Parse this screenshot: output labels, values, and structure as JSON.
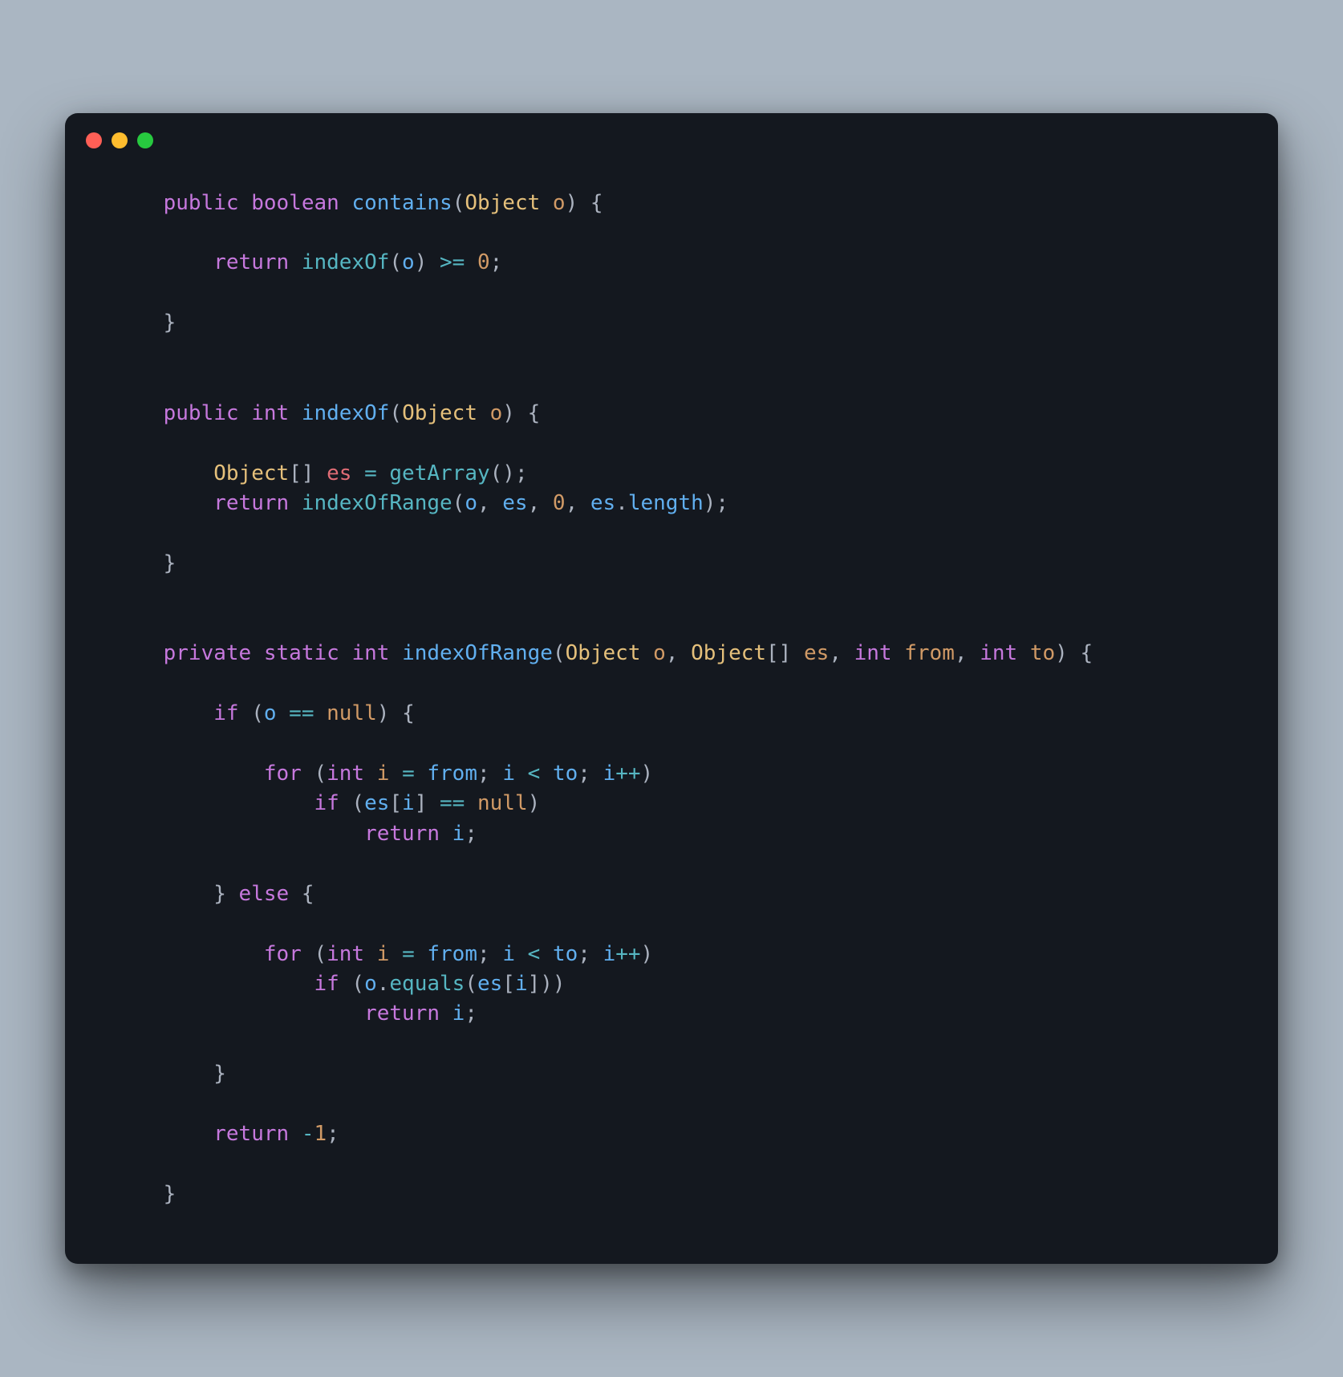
{
  "window": {
    "traffic_lights": [
      "close",
      "minimize",
      "zoom"
    ]
  },
  "code": {
    "tokens": [
      [
        {
          "t": "plain",
          "v": "    "
        },
        {
          "t": "kw",
          "v": "public"
        },
        {
          "t": "plain",
          "v": " "
        },
        {
          "t": "type",
          "v": "boolean"
        },
        {
          "t": "plain",
          "v": " "
        },
        {
          "t": "fn2",
          "v": "contains"
        },
        {
          "t": "punc",
          "v": "("
        },
        {
          "t": "cls",
          "v": "Object"
        },
        {
          "t": "plain",
          "v": " "
        },
        {
          "t": "param",
          "v": "o"
        },
        {
          "t": "punc",
          "v": ")"
        },
        {
          "t": "plain",
          "v": " "
        },
        {
          "t": "punc",
          "v": "{"
        }
      ],
      [],
      [
        {
          "t": "plain",
          "v": "        "
        },
        {
          "t": "kw",
          "v": "return"
        },
        {
          "t": "plain",
          "v": " "
        },
        {
          "t": "fn",
          "v": "indexOf"
        },
        {
          "t": "punc",
          "v": "("
        },
        {
          "t": "var",
          "v": "o"
        },
        {
          "t": "punc",
          "v": ")"
        },
        {
          "t": "plain",
          "v": " "
        },
        {
          "t": "op",
          "v": ">="
        },
        {
          "t": "plain",
          "v": " "
        },
        {
          "t": "num",
          "v": "0"
        },
        {
          "t": "punc",
          "v": ";"
        }
      ],
      [],
      [
        {
          "t": "plain",
          "v": "    "
        },
        {
          "t": "punc",
          "v": "}"
        }
      ],
      [],
      [],
      [
        {
          "t": "plain",
          "v": "    "
        },
        {
          "t": "kw",
          "v": "public"
        },
        {
          "t": "plain",
          "v": " "
        },
        {
          "t": "type",
          "v": "int"
        },
        {
          "t": "plain",
          "v": " "
        },
        {
          "t": "fn2",
          "v": "indexOf"
        },
        {
          "t": "punc",
          "v": "("
        },
        {
          "t": "cls",
          "v": "Object"
        },
        {
          "t": "plain",
          "v": " "
        },
        {
          "t": "param",
          "v": "o"
        },
        {
          "t": "punc",
          "v": ")"
        },
        {
          "t": "plain",
          "v": " "
        },
        {
          "t": "punc",
          "v": "{"
        }
      ],
      [],
      [
        {
          "t": "plain",
          "v": "        "
        },
        {
          "t": "cls",
          "v": "Object"
        },
        {
          "t": "punc",
          "v": "[]"
        },
        {
          "t": "plain",
          "v": " "
        },
        {
          "t": "decl",
          "v": "es"
        },
        {
          "t": "plain",
          "v": " "
        },
        {
          "t": "op",
          "v": "="
        },
        {
          "t": "plain",
          "v": " "
        },
        {
          "t": "fn",
          "v": "getArray"
        },
        {
          "t": "punc",
          "v": "();"
        }
      ],
      [
        {
          "t": "plain",
          "v": "        "
        },
        {
          "t": "kw",
          "v": "return"
        },
        {
          "t": "plain",
          "v": " "
        },
        {
          "t": "fn",
          "v": "indexOfRange"
        },
        {
          "t": "punc",
          "v": "("
        },
        {
          "t": "var",
          "v": "o"
        },
        {
          "t": "punc",
          "v": ", "
        },
        {
          "t": "var",
          "v": "es"
        },
        {
          "t": "punc",
          "v": ", "
        },
        {
          "t": "num",
          "v": "0"
        },
        {
          "t": "punc",
          "v": ", "
        },
        {
          "t": "var",
          "v": "es"
        },
        {
          "t": "punc",
          "v": "."
        },
        {
          "t": "var",
          "v": "length"
        },
        {
          "t": "punc",
          "v": ");"
        }
      ],
      [],
      [
        {
          "t": "plain",
          "v": "    "
        },
        {
          "t": "punc",
          "v": "}"
        }
      ],
      [],
      [],
      [
        {
          "t": "plain",
          "v": "    "
        },
        {
          "t": "kw",
          "v": "private"
        },
        {
          "t": "plain",
          "v": " "
        },
        {
          "t": "kw",
          "v": "static"
        },
        {
          "t": "plain",
          "v": " "
        },
        {
          "t": "type",
          "v": "int"
        },
        {
          "t": "plain",
          "v": " "
        },
        {
          "t": "fn2",
          "v": "indexOfRange"
        },
        {
          "t": "punc",
          "v": "("
        },
        {
          "t": "cls",
          "v": "Object"
        },
        {
          "t": "plain",
          "v": " "
        },
        {
          "t": "param",
          "v": "o"
        },
        {
          "t": "punc",
          "v": ", "
        },
        {
          "t": "cls",
          "v": "Object"
        },
        {
          "t": "punc",
          "v": "[] "
        },
        {
          "t": "param",
          "v": "es"
        },
        {
          "t": "punc",
          "v": ", "
        },
        {
          "t": "type",
          "v": "int"
        },
        {
          "t": "plain",
          "v": " "
        },
        {
          "t": "param",
          "v": "from"
        },
        {
          "t": "punc",
          "v": ", "
        },
        {
          "t": "type",
          "v": "int"
        },
        {
          "t": "plain",
          "v": " "
        },
        {
          "t": "param",
          "v": "to"
        },
        {
          "t": "punc",
          "v": ")"
        },
        {
          "t": "plain",
          "v": " "
        },
        {
          "t": "punc",
          "v": "{"
        }
      ],
      [],
      [
        {
          "t": "plain",
          "v": "        "
        },
        {
          "t": "kw",
          "v": "if"
        },
        {
          "t": "plain",
          "v": " "
        },
        {
          "t": "punc",
          "v": "("
        },
        {
          "t": "var",
          "v": "o"
        },
        {
          "t": "plain",
          "v": " "
        },
        {
          "t": "op",
          "v": "=="
        },
        {
          "t": "plain",
          "v": " "
        },
        {
          "t": "lit",
          "v": "null"
        },
        {
          "t": "punc",
          "v": ")"
        },
        {
          "t": "plain",
          "v": " "
        },
        {
          "t": "punc",
          "v": "{"
        }
      ],
      [],
      [
        {
          "t": "plain",
          "v": "            "
        },
        {
          "t": "kw",
          "v": "for"
        },
        {
          "t": "plain",
          "v": " "
        },
        {
          "t": "punc",
          "v": "("
        },
        {
          "t": "type",
          "v": "int"
        },
        {
          "t": "plain",
          "v": " "
        },
        {
          "t": "param",
          "v": "i"
        },
        {
          "t": "plain",
          "v": " "
        },
        {
          "t": "op",
          "v": "="
        },
        {
          "t": "plain",
          "v": " "
        },
        {
          "t": "var",
          "v": "from"
        },
        {
          "t": "punc",
          "v": "; "
        },
        {
          "t": "var",
          "v": "i"
        },
        {
          "t": "plain",
          "v": " "
        },
        {
          "t": "op",
          "v": "<"
        },
        {
          "t": "plain",
          "v": " "
        },
        {
          "t": "var",
          "v": "to"
        },
        {
          "t": "punc",
          "v": "; "
        },
        {
          "t": "var",
          "v": "i"
        },
        {
          "t": "op",
          "v": "++"
        },
        {
          "t": "punc",
          "v": ")"
        }
      ],
      [
        {
          "t": "plain",
          "v": "                "
        },
        {
          "t": "kw",
          "v": "if"
        },
        {
          "t": "plain",
          "v": " "
        },
        {
          "t": "punc",
          "v": "("
        },
        {
          "t": "var",
          "v": "es"
        },
        {
          "t": "punc",
          "v": "["
        },
        {
          "t": "var",
          "v": "i"
        },
        {
          "t": "punc",
          "v": "]"
        },
        {
          "t": "plain",
          "v": " "
        },
        {
          "t": "op",
          "v": "=="
        },
        {
          "t": "plain",
          "v": " "
        },
        {
          "t": "lit",
          "v": "null"
        },
        {
          "t": "punc",
          "v": ")"
        }
      ],
      [
        {
          "t": "plain",
          "v": "                    "
        },
        {
          "t": "kw",
          "v": "return"
        },
        {
          "t": "plain",
          "v": " "
        },
        {
          "t": "var",
          "v": "i"
        },
        {
          "t": "punc",
          "v": ";"
        }
      ],
      [],
      [
        {
          "t": "plain",
          "v": "        "
        },
        {
          "t": "punc",
          "v": "}"
        },
        {
          "t": "plain",
          "v": " "
        },
        {
          "t": "kw",
          "v": "else"
        },
        {
          "t": "plain",
          "v": " "
        },
        {
          "t": "punc",
          "v": "{"
        }
      ],
      [],
      [
        {
          "t": "plain",
          "v": "            "
        },
        {
          "t": "kw",
          "v": "for"
        },
        {
          "t": "plain",
          "v": " "
        },
        {
          "t": "punc",
          "v": "("
        },
        {
          "t": "type",
          "v": "int"
        },
        {
          "t": "plain",
          "v": " "
        },
        {
          "t": "param",
          "v": "i"
        },
        {
          "t": "plain",
          "v": " "
        },
        {
          "t": "op",
          "v": "="
        },
        {
          "t": "plain",
          "v": " "
        },
        {
          "t": "var",
          "v": "from"
        },
        {
          "t": "punc",
          "v": "; "
        },
        {
          "t": "var",
          "v": "i"
        },
        {
          "t": "plain",
          "v": " "
        },
        {
          "t": "op",
          "v": "<"
        },
        {
          "t": "plain",
          "v": " "
        },
        {
          "t": "var",
          "v": "to"
        },
        {
          "t": "punc",
          "v": "; "
        },
        {
          "t": "var",
          "v": "i"
        },
        {
          "t": "op",
          "v": "++"
        },
        {
          "t": "punc",
          "v": ")"
        }
      ],
      [
        {
          "t": "plain",
          "v": "                "
        },
        {
          "t": "kw",
          "v": "if"
        },
        {
          "t": "plain",
          "v": " "
        },
        {
          "t": "punc",
          "v": "("
        },
        {
          "t": "var",
          "v": "o"
        },
        {
          "t": "punc",
          "v": "."
        },
        {
          "t": "fn",
          "v": "equals"
        },
        {
          "t": "punc",
          "v": "("
        },
        {
          "t": "var",
          "v": "es"
        },
        {
          "t": "punc",
          "v": "["
        },
        {
          "t": "var",
          "v": "i"
        },
        {
          "t": "punc",
          "v": "]))"
        }
      ],
      [
        {
          "t": "plain",
          "v": "                    "
        },
        {
          "t": "kw",
          "v": "return"
        },
        {
          "t": "plain",
          "v": " "
        },
        {
          "t": "var",
          "v": "i"
        },
        {
          "t": "punc",
          "v": ";"
        }
      ],
      [],
      [
        {
          "t": "plain",
          "v": "        "
        },
        {
          "t": "punc",
          "v": "}"
        }
      ],
      [],
      [
        {
          "t": "plain",
          "v": "        "
        },
        {
          "t": "kw",
          "v": "return"
        },
        {
          "t": "plain",
          "v": " "
        },
        {
          "t": "op",
          "v": "-"
        },
        {
          "t": "num",
          "v": "1"
        },
        {
          "t": "punc",
          "v": ";"
        }
      ],
      [],
      [
        {
          "t": "plain",
          "v": "    "
        },
        {
          "t": "punc",
          "v": "}"
        }
      ]
    ]
  }
}
